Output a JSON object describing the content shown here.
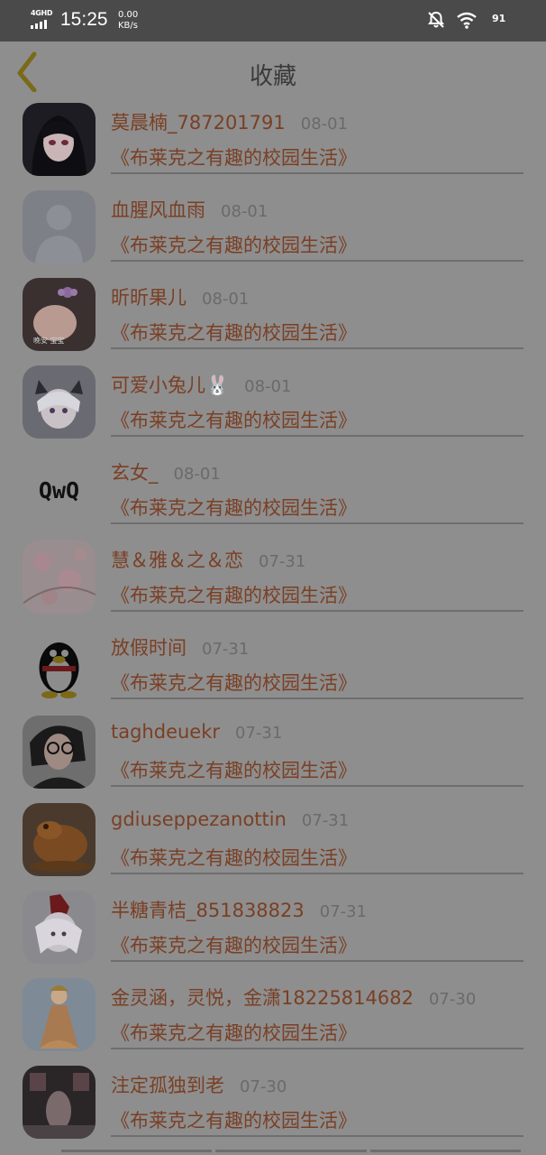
{
  "status_bar": {
    "network": "4GHD",
    "time": "15:25",
    "speed_value": "0.00",
    "speed_unit": "KB/s",
    "battery": "91",
    "icons": [
      "mute-bell-icon",
      "wifi-icon",
      "battery-icon"
    ]
  },
  "header": {
    "title": "收藏",
    "back_icon": "chevron-left-icon"
  },
  "colors": {
    "accent": "#7a3f24",
    "back_icon": "#7a6a18",
    "overlay_bg": "#8e8e8e"
  },
  "favorites": [
    {
      "username": "莫晨楠_787201791",
      "date": "08-01",
      "book": "《布莱克之有趣的校园生活》",
      "avatar": "anime-girl-dark"
    },
    {
      "username": "血腥风血雨",
      "date": "08-01",
      "book": "《布莱克之有趣的校园生活》",
      "avatar": "default-silhouette"
    },
    {
      "username": "昕昕果儿",
      "date": "08-01",
      "book": "《布莱克之有趣的校园生活》",
      "avatar": "baby-photo",
      "avatar_text": "晚安 宝宝"
    },
    {
      "username": "可爱小兔儿🐰",
      "date": "08-01",
      "book": "《布莱克之有趣的校园生活》",
      "avatar": "anime-cat-girl"
    },
    {
      "username": "玄女_",
      "date": "08-01",
      "book": "《布莱克之有趣的校园生活》",
      "avatar": "qwq-text",
      "avatar_text": "QwQ"
    },
    {
      "username": "慧＆雅＆之＆恋",
      "date": "07-31",
      "book": "《布莱克之有趣的校园生活》",
      "avatar": "cherry-blossom"
    },
    {
      "username": "放假时间",
      "date": "07-31",
      "book": "《布莱克之有趣的校园生活》",
      "avatar": "qq-penguin"
    },
    {
      "username": "taghdeuekr",
      "date": "07-31",
      "book": "《布莱克之有趣的校园生活》",
      "avatar": "girl-glasses"
    },
    {
      "username": "gdiuseppezanottin",
      "date": "07-31",
      "book": "《布莱克之有趣的校园生活》",
      "avatar": "wooden-toad"
    },
    {
      "username": "半糖青桔_851838823",
      "date": "07-31",
      "book": "《布莱克之有趣的校园生活》",
      "avatar": "anime-white-hair"
    },
    {
      "username": "金灵涵，灵悦，金潇18225814682",
      "date": "07-30",
      "book": "《布莱克之有趣的校园生活》",
      "avatar": "princess-doll"
    },
    {
      "username": "注定孤独到老",
      "date": "07-30",
      "book": "《布莱克之有趣的校园生活》",
      "avatar": "room-photo"
    }
  ]
}
